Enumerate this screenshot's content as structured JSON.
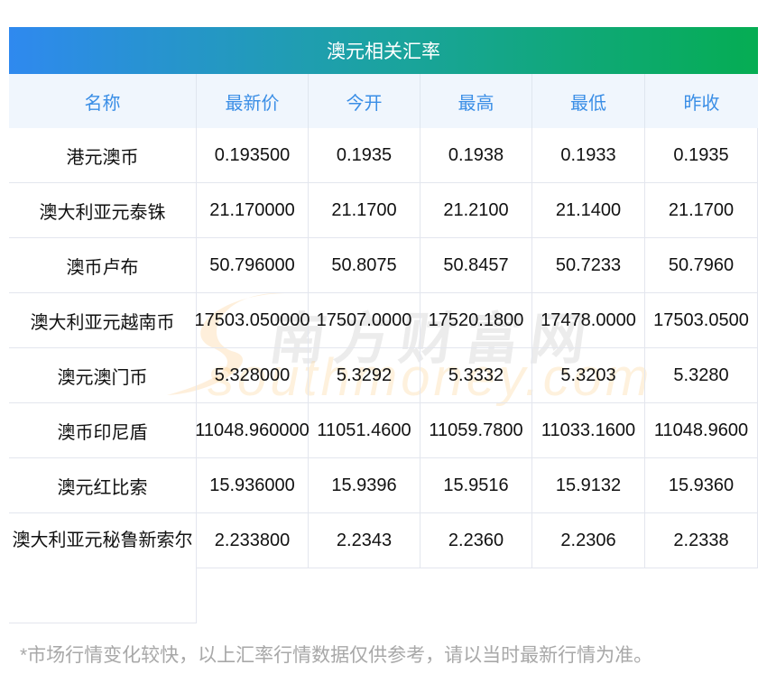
{
  "title": "澳元相关汇率",
  "headers": [
    "名称",
    "最新价",
    "今开",
    "最高",
    "最低",
    "昨收"
  ],
  "rows": [
    [
      "港元澳币",
      "0.193500",
      "0.1935",
      "0.1938",
      "0.1933",
      "0.1935"
    ],
    [
      "澳大利亚元泰铢",
      "21.170000",
      "21.1700",
      "21.2100",
      "21.1400",
      "21.1700"
    ],
    [
      "澳币卢布",
      "50.796000",
      "50.8075",
      "50.8457",
      "50.7233",
      "50.7960"
    ],
    [
      "澳大利亚元越南币",
      "17503.050000",
      "17507.0000",
      "17520.1800",
      "17478.0000",
      "17503.0500"
    ],
    [
      "澳元澳门币",
      "5.328000",
      "5.3292",
      "5.3332",
      "5.3203",
      "5.3280"
    ],
    [
      "澳币印尼盾",
      "11048.960000",
      "11051.4600",
      "11059.7800",
      "11033.1600",
      "11048.9600"
    ],
    [
      "澳元红比索",
      "15.936000",
      "15.9396",
      "15.9516",
      "15.9132",
      "15.9360"
    ],
    [
      "澳大利亚元秘鲁新索尔",
      "2.233800",
      "2.2343",
      "2.2360",
      "2.2306",
      "2.2338"
    ]
  ],
  "watermark": {
    "cn": "南方财富网",
    "en": "southmoney.com"
  },
  "footer": "*市场行情变化较快，以上汇率行情数据仅供参考，请以当时最新行情为准。"
}
